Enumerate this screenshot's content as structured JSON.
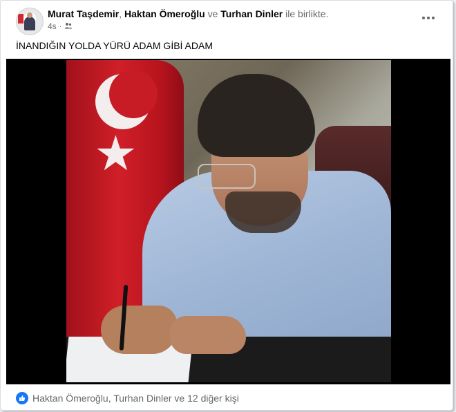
{
  "post": {
    "authors": [
      "Murat Taşdemir",
      "Haktan Ömeroğlu",
      "Turhan Dinler"
    ],
    "author_separator_1": ", ",
    "author_separator_2": " ve ",
    "with_suffix": " ile birlikte.",
    "time": "4s",
    "audience_icon": "friends-icon",
    "text": "İNANDIĞIN YOLDA YÜRÜ ADAM GİBİ ADAM"
  },
  "reactions": {
    "icon": "like-icon",
    "summary": "Haktan Ömeroğlu, Turhan Dinler ve 12 diğer kişi"
  },
  "colors": {
    "accent": "#1877f2",
    "text_primary": "#050505",
    "text_secondary": "#65676b",
    "flag_red": "#d01f28"
  }
}
